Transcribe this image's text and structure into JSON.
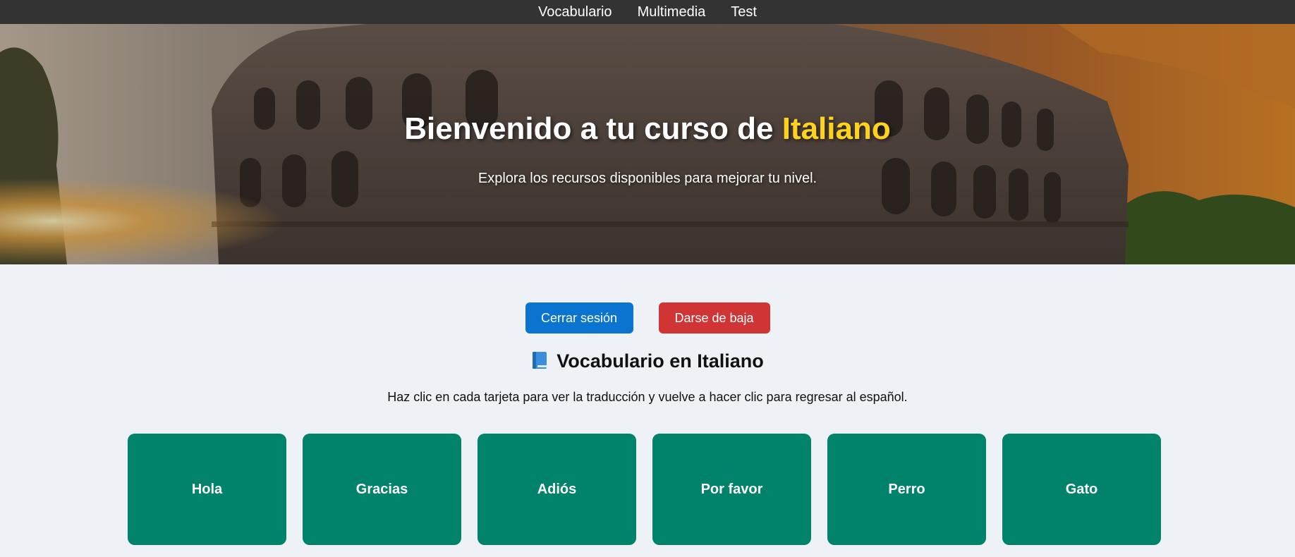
{
  "nav": {
    "items": [
      {
        "label": "Vocabulario"
      },
      {
        "label": "Multimedia"
      },
      {
        "label": "Test"
      }
    ]
  },
  "hero": {
    "title_prefix": "Bienvenido a tu curso de ",
    "title_accent": "Italiano",
    "subtitle": "Explora los recursos disponibles para mejorar tu nivel.",
    "accent_color": "#ffd21f"
  },
  "actions": {
    "logout_label": "Cerrar sesión",
    "unsubscribe_label": "Darse de baja",
    "logout_color": "#0a74d0",
    "unsubscribe_color": "#d03434"
  },
  "vocab": {
    "icon": "blue-book-icon",
    "title": "Vocabulario en Italiano",
    "description": "Haz clic en cada tarjeta para ver la traducción y vuelve a hacer clic para regresar al español.",
    "card_color": "#00826b",
    "cards": [
      {
        "label": "Hola"
      },
      {
        "label": "Gracias"
      },
      {
        "label": "Adiós"
      },
      {
        "label": "Por favor"
      },
      {
        "label": "Perro"
      },
      {
        "label": "Gato"
      }
    ]
  }
}
